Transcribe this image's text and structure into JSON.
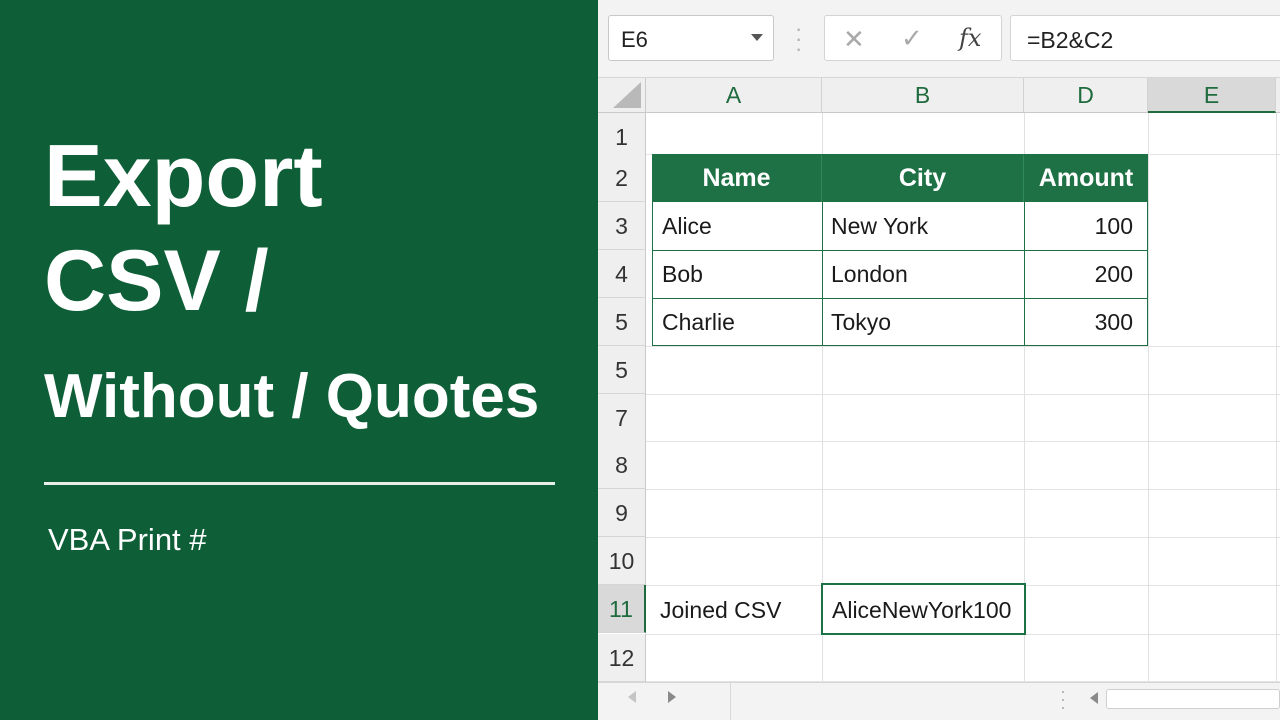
{
  "banner": {
    "title_line1": "Export",
    "title_line2": "CSV /",
    "title_line3": "Without / Quotes",
    "subtitle": "VBA Print #"
  },
  "formula_bar": {
    "name_box": "E6",
    "fx_label": "fx",
    "cancel_glyph": "✕",
    "enter_glyph": "✓",
    "formula": "=B2&C2"
  },
  "columns": [
    "A",
    "B",
    "D",
    "E"
  ],
  "rows": [
    "1",
    "2",
    "3",
    "4",
    "5",
    "5",
    "7",
    "8",
    "9",
    "10",
    "11",
    "12"
  ],
  "table": {
    "headers": [
      "Name",
      "City",
      "Amount"
    ],
    "rows": [
      [
        "Alice",
        "New York",
        "100"
      ],
      [
        "Bob",
        "London",
        "200"
      ],
      [
        "Charlie",
        "Tokyo",
        "300"
      ]
    ]
  },
  "row11": {
    "label": "Joined CSV",
    "value": "AliceNewYork100"
  },
  "icons": {
    "name_box_dropdown": "chevron-down-icon",
    "sheet_prev": "triangle-left-icon",
    "sheet_next": "triangle-right-icon",
    "scroll_left": "triangle-left-icon"
  },
  "colors": {
    "banner_bg": "#0e5e37",
    "accent": "#1e7145"
  }
}
